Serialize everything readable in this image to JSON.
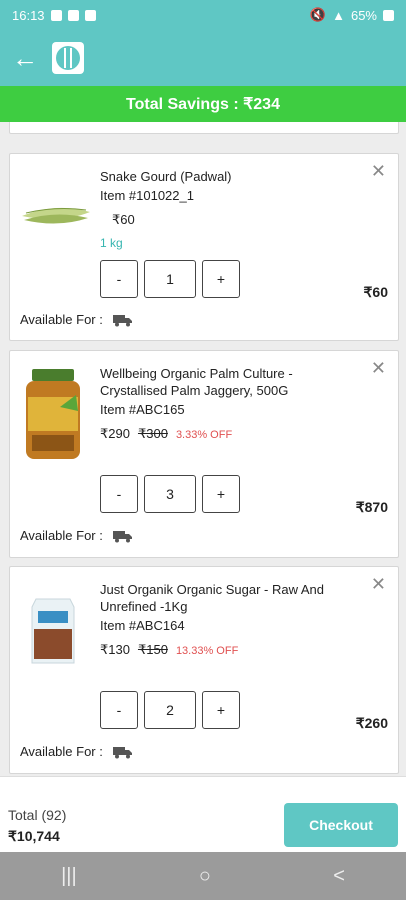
{
  "status": {
    "time": "16:13",
    "battery": "65%"
  },
  "header": {
    "back_icon": "back-arrow-icon",
    "logo_icon": "app-logo-icon"
  },
  "savings": {
    "label": "Total Savings : ₹234"
  },
  "items": [
    {
      "name": "Snake Gourd (Padwal)",
      "sku": "Item #101022_1",
      "price": "₹60",
      "mrp": "",
      "off": "",
      "unit": "1 kg",
      "qty": "1",
      "line_total": "₹60",
      "available_label": "Available For :"
    },
    {
      "name": "Wellbeing Organic Palm Culture - Crystallised Palm Jaggery, 500G",
      "sku": "Item #ABC165",
      "price": "₹290",
      "mrp": "₹300",
      "off": "3.33% OFF",
      "unit": "",
      "qty": "3",
      "line_total": "₹870",
      "available_label": "Available For :"
    },
    {
      "name": "Just Organik Organic Sugar - Raw And Unrefined -1Kg",
      "sku": "Item #ABC164",
      "price": "₹130",
      "mrp": "₹150",
      "off": "13.33% OFF",
      "unit": "",
      "qty": "2",
      "line_total": "₹260",
      "available_label": "Available For :"
    }
  ],
  "qty_controls": {
    "minus": "-",
    "plus": "+"
  },
  "footer": {
    "total_label": "Total (92)",
    "total_value": "₹10,744",
    "checkout_label": "Checkout"
  },
  "nav": {
    "recents": "|||",
    "home": "○",
    "back": "<"
  },
  "colors": {
    "accent": "#5fc7c4",
    "savings_green": "#3ecd41",
    "discount_red": "#e05050"
  }
}
